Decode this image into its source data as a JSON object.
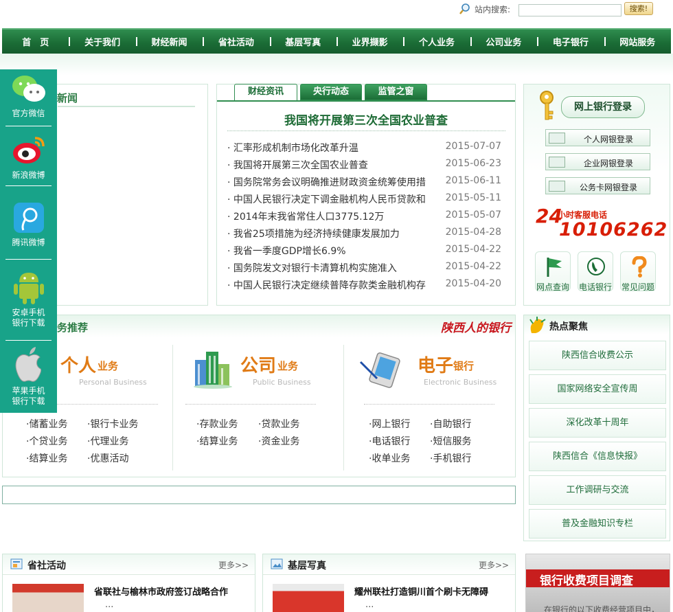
{
  "search": {
    "label": "站内搜索:",
    "button": "搜索",
    "placeholder": ""
  },
  "nav": [
    "首　页",
    "关于我们",
    "财经新闻",
    "省社活动",
    "基层写真",
    "业界撷影",
    "个人业务",
    "公司业务",
    "电子银行",
    "网站服务"
  ],
  "left_panel": {
    "title": "新闻"
  },
  "center": {
    "tabs": [
      "财经资讯",
      "央行动态",
      "监管之窗"
    ],
    "headline": "我国将开展第三次全国农业普查",
    "news": [
      {
        "title": "汇率形成机制市场化改革升温",
        "date": "2015-07-07"
      },
      {
        "title": "我国将开展第三次全国农业普查",
        "date": "2015-06-23"
      },
      {
        "title": "国务院常务会议明确推进财政资金统筹使用措",
        "date": "2015-06-11"
      },
      {
        "title": "中国人民银行决定下调金融机构人民币贷款和",
        "date": "2015-05-11"
      },
      {
        "title": "2014年末我省常住人口3775.12万",
        "date": "2015-05-07"
      },
      {
        "title": "我省25项措施为经济持续健康发展加力",
        "date": "2015-04-28"
      },
      {
        "title": "我省一季度GDP增长6.9%",
        "date": "2015-04-22"
      },
      {
        "title": "国务院发文对银行卡清算机构实施准入",
        "date": "2015-04-22"
      },
      {
        "title": "中国人民银行决定继续普降存款类金融机构存",
        "date": "2015-04-20"
      }
    ]
  },
  "login": {
    "title": "网上银行登录",
    "buttons": [
      "个人网银登录",
      "企业网银登录",
      "公务卡网银登录"
    ],
    "hotline_24": "24",
    "hotline_label": "小时客服电话",
    "hotline_number": "10106262",
    "services": [
      "网点查询",
      "电话银行",
      "常见问题"
    ]
  },
  "business": {
    "title": "务推荐",
    "bank_logo": "陕西人的银行",
    "columns": [
      {
        "big": "个人",
        "sub": "业务",
        "en": "Personal Business",
        "links": [
          "储蓄业务",
          "银行卡业务",
          "个贷业务",
          "代理业务",
          "结算业务",
          "优惠活动"
        ]
      },
      {
        "big": "公司",
        "sub": "业务",
        "en": "Public Business",
        "links": [
          "存款业务",
          "贷款业务",
          "结算业务",
          "资金业务"
        ]
      },
      {
        "big": "电子",
        "sub": "银行",
        "en": "Electronic Business",
        "links": [
          "网上银行",
          "自助银行",
          "电话银行",
          "短信服务",
          "收单业务",
          "手机银行"
        ]
      }
    ]
  },
  "hot": {
    "title": "热点聚焦",
    "items": [
      "陕西信合收费公示",
      "国家网络安全宣传周",
      "深化改革十周年",
      "陕西信合《信息快报》",
      "工作调研与交流",
      "普及金融知识专栏"
    ]
  },
  "bottom": [
    {
      "title": "省社活动",
      "more": "更多>>",
      "headline": "省联社与榆林市政府签订战略合作",
      "ellipsis": "..."
    },
    {
      "title": "基层写真",
      "more": "更多>>",
      "headline": "耀州联社打造铜川首个刷卡无障碍",
      "ellipsis": "..."
    }
  ],
  "promo": {
    "title": "银行收费项目调查",
    "sub": "在银行的以下收费经营项目中，"
  },
  "sidebar": [
    "官方微信",
    "新浪微博",
    "腾讯微博",
    "安卓手机银行下载",
    "苹果手机银行下载"
  ],
  "colors": {
    "nav_green": "#1b6d36",
    "brand_green": "#2e7d46",
    "sidebar_teal": "#18a389",
    "accent_red": "#d81e06",
    "accent_orange": "#e07b16"
  }
}
